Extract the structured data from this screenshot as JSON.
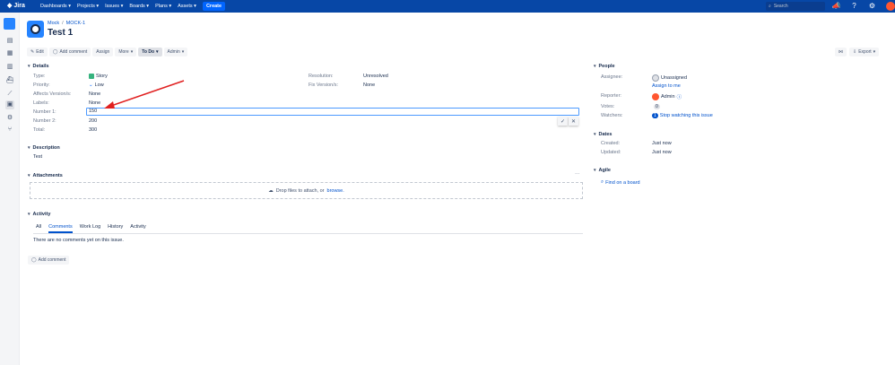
{
  "nav": {
    "logo": "Jira",
    "menu": [
      "Dashboards",
      "Projects",
      "Issues",
      "Boards",
      "Plans",
      "Assets"
    ],
    "create": "Create",
    "search_placeholder": "Search"
  },
  "breadcrumb": {
    "project": "Mock",
    "sep": "/",
    "issue_key": "MOCK-1"
  },
  "issue": {
    "title": "Test 1"
  },
  "toolbar": {
    "edit": "Edit",
    "add_comment": "Add comment",
    "assign": "Assign",
    "more": "More",
    "status": "To Do",
    "admin": "Admin",
    "export": "Export"
  },
  "details": {
    "heading": "Details",
    "type_label": "Type:",
    "type_value": "Story",
    "priority_label": "Priority:",
    "priority_value": "Low",
    "affects_label": "Affects Version/s:",
    "affects_value": "None",
    "labels_label": "Labels:",
    "labels_value": "None",
    "number1_label": "Number 1:",
    "number1_value": "150",
    "number2_label": "Number 2:",
    "number2_value": "200",
    "total_label": "Total:",
    "total_value": "300",
    "resolution_label": "Resolution:",
    "resolution_value": "Unresolved",
    "fixversion_label": "Fix Version/s:",
    "fixversion_value": "None"
  },
  "description": {
    "heading": "Description",
    "text": "Test"
  },
  "attachments": {
    "heading": "Attachments",
    "drop_text": "Drop files to attach, or",
    "browse": "browse."
  },
  "activity": {
    "heading": "Activity",
    "tabs": [
      "All",
      "Comments",
      "Work Log",
      "History",
      "Activity"
    ],
    "empty": "There are no comments yet on this issue.",
    "add_comment": "Add comment"
  },
  "people": {
    "heading": "People",
    "assignee_label": "Assignee:",
    "assignee_value": "Unassigned",
    "assign_to_me": "Assign to me",
    "reporter_label": "Reporter:",
    "reporter_value": "Admin",
    "votes_label": "Votes:",
    "votes_value": "0",
    "watchers_label": "Watchers:",
    "watchers_count": "1",
    "watchers_action": "Stop watching this issue"
  },
  "dates": {
    "heading": "Dates",
    "created_label": "Created:",
    "created_value": "Just now",
    "updated_label": "Updated:",
    "updated_value": "Just now"
  },
  "agile": {
    "heading": "Agile",
    "find_on_board": "Find on a board"
  },
  "colors": {
    "nav": "#0747a6",
    "accent": "#0052cc",
    "annotation_arrow": "#e02020"
  }
}
